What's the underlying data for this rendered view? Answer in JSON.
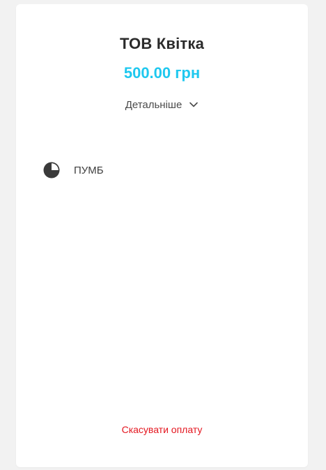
{
  "merchant": {
    "name": "ТОВ Квітка"
  },
  "payment": {
    "amount": "500.00 грн",
    "details_label": "Детальніше"
  },
  "bank_option": {
    "name": "ПУМБ",
    "icon": "pie-chart-icon"
  },
  "actions": {
    "cancel_label": "Скасувати оплату"
  },
  "colors": {
    "accent": "#1fc8ef",
    "danger": "#e4161f",
    "text": "#2b2b2b"
  }
}
